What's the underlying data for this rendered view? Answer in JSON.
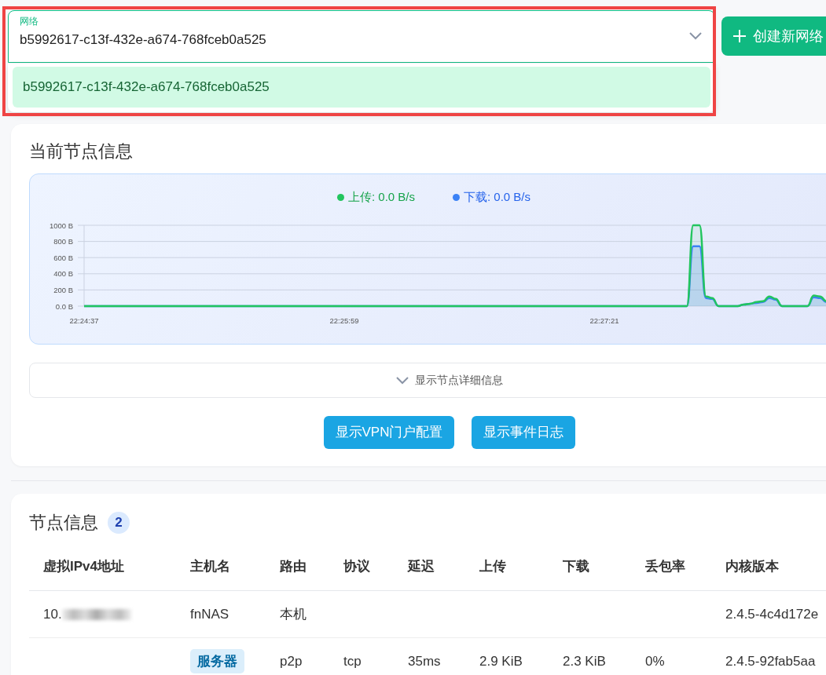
{
  "network_select": {
    "label": "网络",
    "value": "b5992617-c13f-432e-a674-768fceb0a525",
    "open": true,
    "options": [
      {
        "label": "b5992617-c13f-432e-a674-768fceb0a525",
        "selected": true
      }
    ]
  },
  "create_button": {
    "label": "创建新网络"
  },
  "node_card": {
    "title": "当前节点信息",
    "legend": [
      {
        "reading": ": 0.0 B/s"
      },
      {
        "reading": ": 0.0 B/s"
      }
    ],
    "chart_data": {
      "type": "area",
      "categories": [
        "22:24:37",
        null,
        null,
        null,
        null,
        null,
        null,
        null,
        null,
        null,
        null,
        null,
        null,
        null,
        null,
        null,
        null,
        null,
        null,
        null,
        null,
        null,
        null,
        null,
        null,
        null,
        null,
        null,
        null,
        null,
        null,
        null,
        null,
        null,
        null,
        null,
        null,
        null,
        null,
        null,
        null,
        "22:25:59",
        null,
        null,
        null,
        null,
        null,
        null,
        null,
        null,
        null,
        null,
        null,
        null,
        null,
        null,
        null,
        null,
        null,
        null,
        null,
        null,
        null,
        null,
        null,
        null,
        null,
        null,
        null,
        null,
        null,
        null,
        null,
        null,
        null,
        null,
        null,
        null,
        null,
        null,
        null,
        null,
        "22:27:21",
        null,
        null,
        null,
        null,
        null,
        null,
        null,
        null,
        null,
        null,
        null,
        null,
        null,
        null,
        null,
        null,
        null,
        null,
        null,
        null,
        null,
        null,
        null,
        null,
        null,
        null,
        null,
        null,
        null,
        null,
        null,
        null,
        null,
        null,
        null
      ],
      "series": [
        {
          "name": "上传",
          "color": "#22c55e",
          "values": [
            0,
            0,
            0,
            0,
            0,
            0,
            0,
            0,
            0,
            0,
            0,
            0,
            0,
            0,
            0,
            0,
            0,
            0,
            0,
            0,
            0,
            0,
            0,
            0,
            0,
            0,
            0,
            0,
            0,
            0,
            0,
            0,
            0,
            0,
            0,
            0,
            0,
            0,
            0,
            0,
            0,
            0,
            0,
            0,
            0,
            0,
            0,
            0,
            0,
            0,
            0,
            0,
            0,
            0,
            0,
            0,
            0,
            0,
            0,
            0,
            0,
            0,
            0,
            0,
            0,
            0,
            0,
            0,
            0,
            0,
            0,
            0,
            0,
            0,
            0,
            0,
            0,
            0,
            0,
            0,
            0,
            0,
            0,
            0,
            0,
            0,
            0,
            0,
            0,
            0,
            0,
            0,
            0,
            0,
            0,
            0,
            1000,
            1000,
            120,
            100,
            0,
            0,
            0,
            0,
            20,
            30,
            50,
            60,
            120,
            90,
            0,
            0,
            0,
            0,
            0,
            130,
            120,
            60
          ]
        },
        {
          "name": "下载",
          "color": "#3b82f6",
          "values": [
            0,
            0,
            0,
            0,
            0,
            0,
            0,
            0,
            0,
            0,
            0,
            0,
            0,
            0,
            0,
            0,
            0,
            0,
            0,
            0,
            0,
            0,
            0,
            0,
            0,
            0,
            0,
            0,
            0,
            0,
            0,
            0,
            0,
            0,
            0,
            0,
            0,
            0,
            0,
            0,
            0,
            0,
            0,
            0,
            0,
            0,
            0,
            0,
            0,
            0,
            0,
            0,
            0,
            0,
            0,
            0,
            0,
            0,
            0,
            0,
            0,
            0,
            0,
            0,
            0,
            0,
            0,
            0,
            0,
            0,
            0,
            0,
            0,
            0,
            0,
            0,
            0,
            0,
            0,
            0,
            0,
            0,
            0,
            0,
            0,
            0,
            0,
            0,
            0,
            0,
            0,
            0,
            0,
            0,
            0,
            0,
            740,
            740,
            100,
            90,
            0,
            0,
            0,
            0,
            20,
            30,
            40,
            50,
            100,
            80,
            0,
            0,
            0,
            0,
            0,
            110,
            100,
            50
          ]
        }
      ],
      "ylim": [
        0,
        1000
      ],
      "grid": true,
      "yticks": [
        {
          "value": 0,
          "label": "0.0 B"
        },
        {
          "value": 200,
          "label": "200 B"
        },
        {
          "value": 400,
          "label": "400 B"
        },
        {
          "value": 600,
          "label": "600 B"
        },
        {
          "value": 800,
          "label": "800 B"
        },
        {
          "value": 1000,
          "label": "1000 B"
        }
      ]
    },
    "details_toggle": {
      "label": "显示节点详细信息",
      "expanded": false
    },
    "buttons": [
      "显示VPN门户配置",
      "显示事件日志"
    ]
  },
  "peers": {
    "title": "节点信息",
    "count": "2",
    "columns": [
      "虚拟IPv4地址",
      "主机名",
      "路由",
      "协议",
      "延迟",
      "上传",
      "下载",
      "丢包率",
      "内核版本"
    ],
    "rows": [
      {
        "cells": [
          {
            "kind": "masked",
            "text": "10."
          },
          {
            "kind": "text",
            "text": "fnNAS"
          },
          {
            "kind": "text",
            "text": "本机"
          },
          {
            "kind": "empty"
          },
          {
            "kind": "empty"
          },
          {
            "kind": "empty"
          },
          {
            "kind": "empty"
          },
          {
            "kind": "empty"
          },
          {
            "kind": "text",
            "text": "2.4.5-4c4d172e"
          }
        ]
      },
      {
        "cells": [
          {
            "kind": "empty"
          },
          {
            "kind": "tag",
            "text": "服务器"
          },
          {
            "kind": "text",
            "text": "p2p"
          },
          {
            "kind": "text",
            "text": "tcp"
          },
          {
            "kind": "text",
            "text": "35ms"
          },
          {
            "kind": "text",
            "text": "2.9 KiB"
          },
          {
            "kind": "text",
            "text": "2.3 KiB"
          },
          {
            "kind": "text",
            "text": "0%"
          },
          {
            "kind": "text",
            "text": "2.4.5-92fab5aa"
          }
        ]
      }
    ]
  }
}
